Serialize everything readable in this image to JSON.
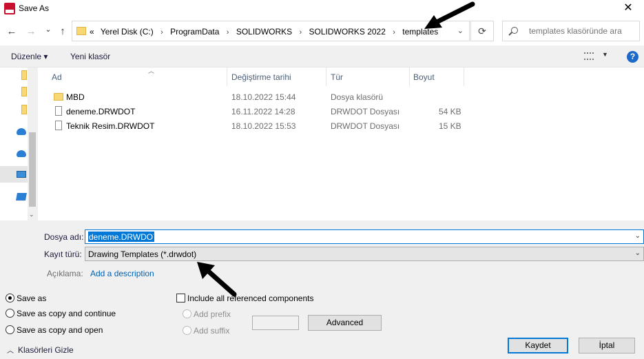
{
  "window": {
    "title": "Save As",
    "close_glyph": "✕"
  },
  "nav": {
    "back_glyph": "←",
    "forward_glyph": "→",
    "recent_glyph": "⌄",
    "up_glyph": "↑",
    "refresh_glyph": "⟳",
    "overflow": "«",
    "breadcrumbs": [
      "Yerel Disk (C:)",
      "ProgramData",
      "SOLIDWORKS",
      "SOLIDWORKS 2022",
      "templates"
    ],
    "separator": "›",
    "search_placeholder": "templates klasöründe ara"
  },
  "toolbar": {
    "organize_label": "Düzenle ▾",
    "new_folder_label": "Yeni klasör",
    "help": "?"
  },
  "columns": {
    "name": "Ad",
    "date": "Değiştirme tarihi",
    "type": "Tür",
    "size": "Boyut"
  },
  "files": [
    {
      "name": "MBD",
      "date": "18.10.2022 15:44",
      "type": "Dosya klasörü",
      "size": "",
      "icon": "folder"
    },
    {
      "name": "deneme.DRWDOT",
      "date": "16.11.2022 14:28",
      "type": "DRWDOT Dosyası",
      "size": "54 KB",
      "icon": "document"
    },
    {
      "name": "Teknik Resim.DRWDOT",
      "date": "18.10.2022 15:53",
      "type": "DRWDOT Dosyası",
      "size": "15 KB",
      "icon": "document"
    }
  ],
  "form": {
    "filename_label": "Dosya adı:",
    "filename_value": "deneme.DRWDOT",
    "filetype_label": "Kayıt türü:",
    "filetype_value": "Drawing Templates (*.drwdot)",
    "description_label": "Açıklama:",
    "description_link": "Add a description"
  },
  "options": {
    "save_as": "Save as",
    "save_copy_continue": "Save as copy and continue",
    "save_copy_open": "Save as copy and open",
    "include_refs": "Include all referenced components",
    "add_prefix": "Add prefix",
    "add_suffix": "Add suffix",
    "selected": "save_as"
  },
  "buttons": {
    "advanced": "Advanced",
    "save": "Kaydet",
    "cancel": "İptal"
  },
  "hide_folders": "Klasörleri Gizle",
  "colors": {
    "accent": "#0078d7",
    "link": "#0060b3",
    "folder": "#f8d775"
  }
}
